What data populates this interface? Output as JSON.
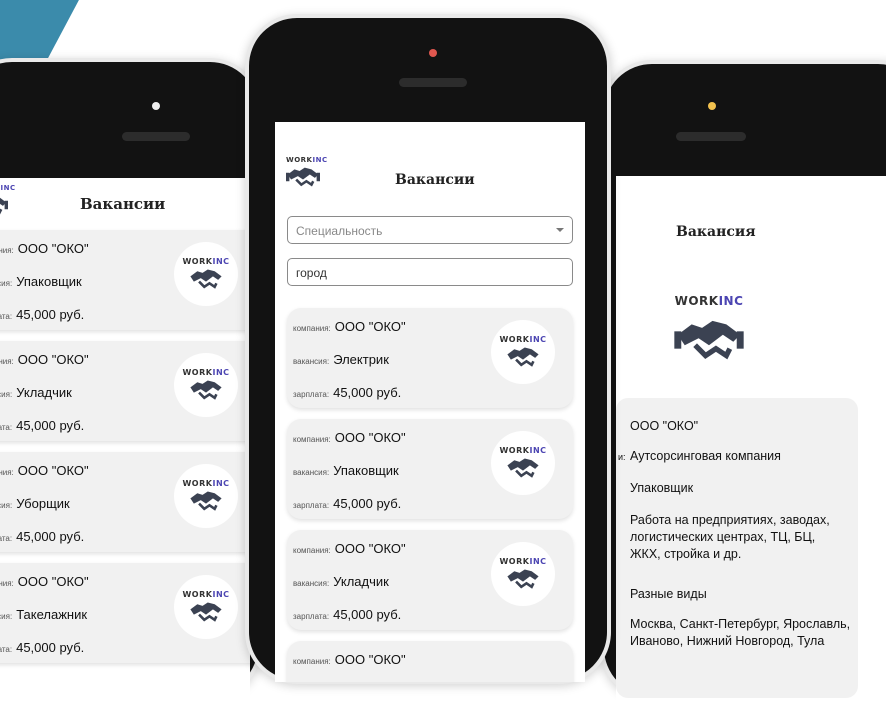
{
  "screens": {
    "list_left": {
      "title": "Вакансии",
      "labels": {
        "company": "компания:",
        "vacancy": "вакансия:",
        "salary": "зарплата:"
      },
      "cards": [
        {
          "company": "ООО \"ОКО\"",
          "vacancy": "Упаковщик",
          "salary": "45,000 руб."
        },
        {
          "company": "ООО \"ОКО\"",
          "vacancy": "Укладчик",
          "salary": "45,000 руб."
        },
        {
          "company": "ООО \"ОКО\"",
          "vacancy": "Уборщик",
          "salary": "45,000 руб."
        },
        {
          "company": "ООО \"ОКО\"",
          "vacancy": "Такелажник",
          "salary": "45,000 руб."
        }
      ]
    },
    "list_center": {
      "title": "Вакансии",
      "specialty_placeholder": "Специальность",
      "city_value": "город",
      "labels": {
        "company": "компания:",
        "vacancy": "вакансия:",
        "salary": "зарплата:"
      },
      "cards": [
        {
          "company": "ООО \"ОКО\"",
          "vacancy": "Электрик",
          "salary": "45,000 руб."
        },
        {
          "company": "ООО \"ОКО\"",
          "vacancy": "Упаковщик",
          "salary": "45,000 руб."
        },
        {
          "company": "ООО \"ОКО\"",
          "vacancy": "Укладчик",
          "salary": "45,000 руб."
        },
        {
          "company": "ООО \"ОКО\"",
          "vacancy": "",
          "salary": ""
        }
      ]
    },
    "detail_right": {
      "title": "Вакансия",
      "company": "ООО \"ОКО\"",
      "company_label_fragment": "и:",
      "company_type": "Аутсорсинговая компания",
      "vacancy": "Упаковщик",
      "description": "Работа на предприятиях, заводах, логистических центрах, ТЦ, БЦ, ЖКХ, стройка и др.",
      "types": "Разные виды",
      "cities": "Москва, Санкт-Петербург, Ярославль, Иваново, Нижний Новгород, Тула"
    }
  },
  "logo": {
    "word_main": "WORK",
    "word_accent": "INC"
  },
  "colors": {
    "accent": "#4c45b2",
    "stripe": "#3b8bab",
    "cam_center": "#e0574f",
    "cam_right": "#f2c14e"
  }
}
